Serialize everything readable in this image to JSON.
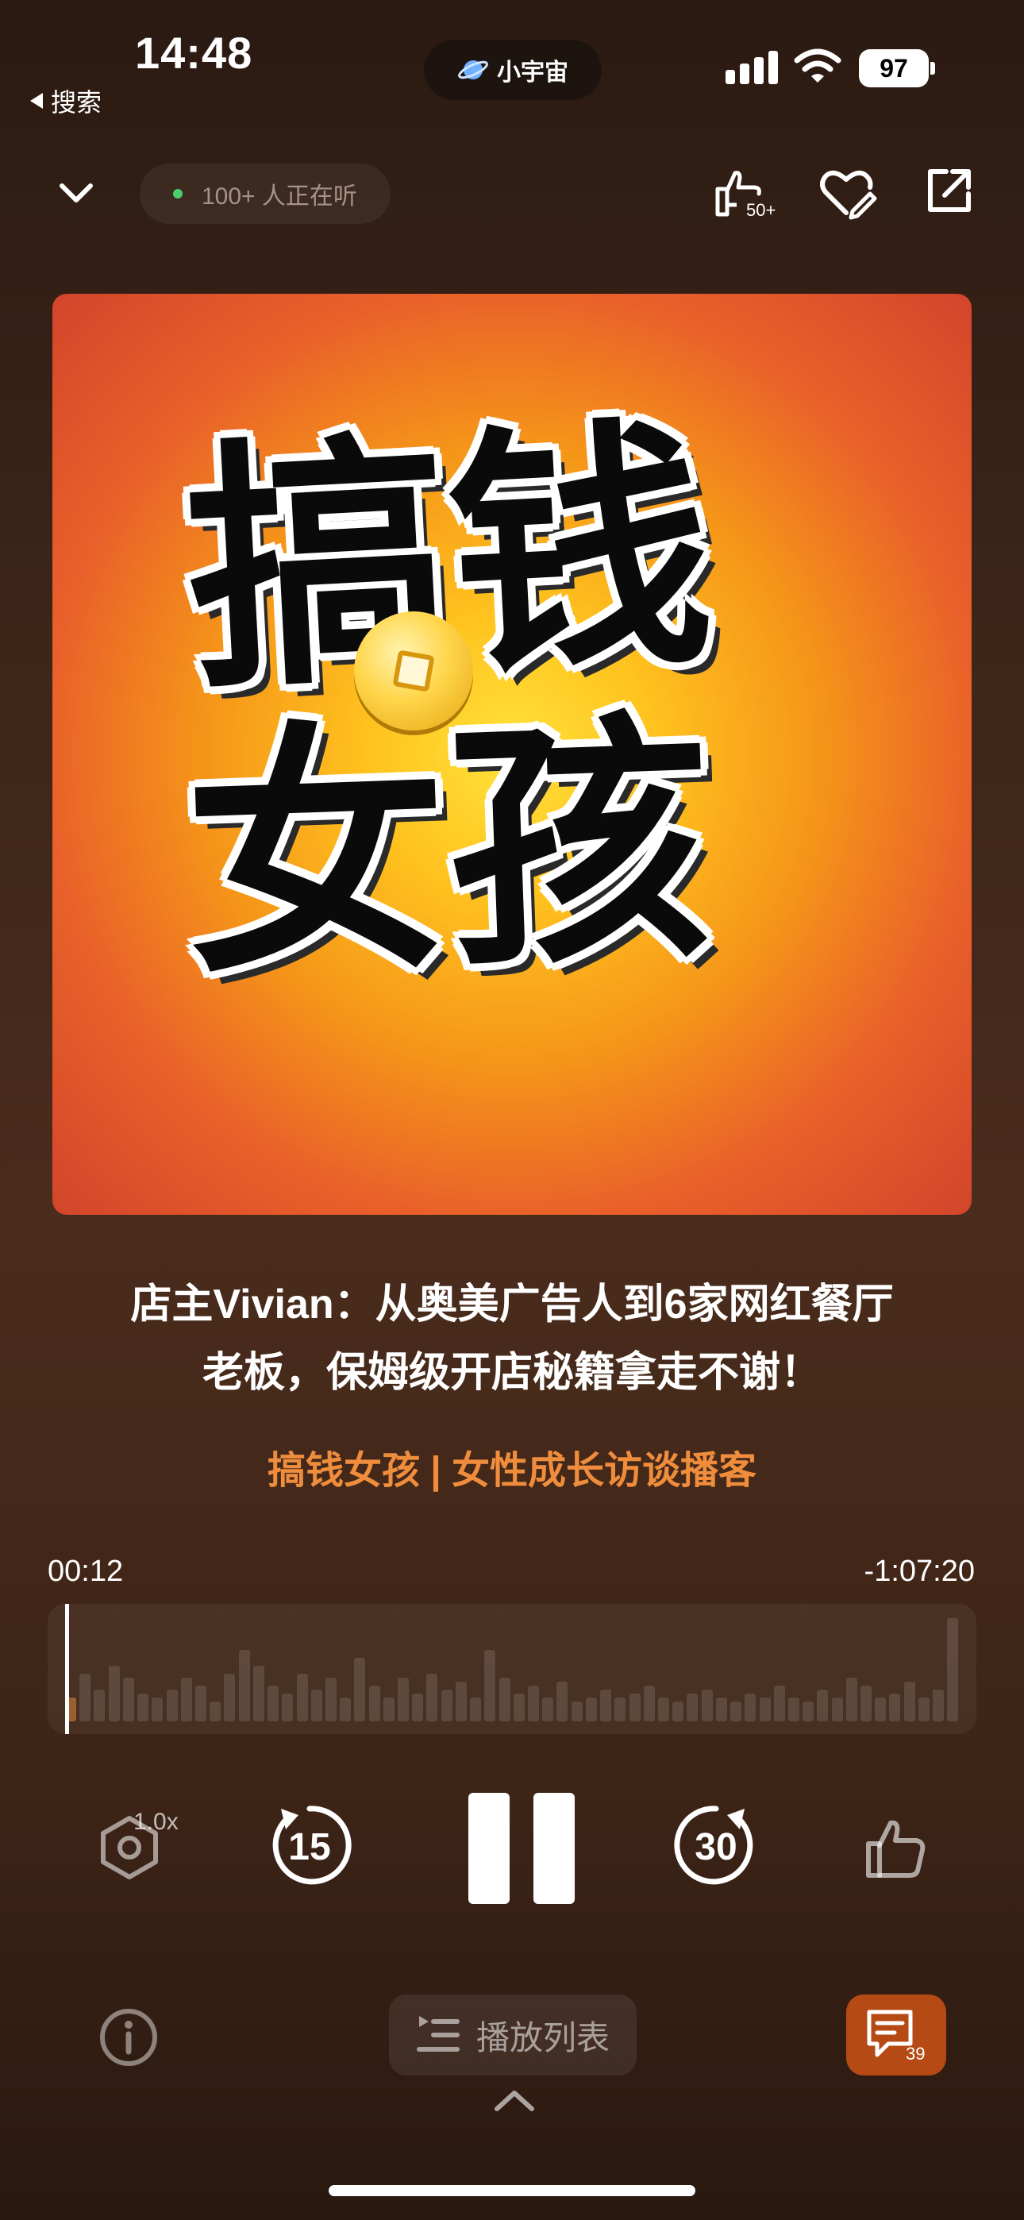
{
  "status_bar": {
    "time": "14:48",
    "back_label": "搜索",
    "app_pill": "小宇宙",
    "battery": "97"
  },
  "header": {
    "listening": "100+ 人正在听",
    "recommend_count": "50+"
  },
  "cover": {
    "line1": "搞钱",
    "line2": "女孩"
  },
  "episode": {
    "title_line1": "店主Vivian：从奥美广告人到6家网红餐厅",
    "title_line2": "老板，保姆级开店秘籍拿走不谢！",
    "podcast": "搞钱女孩 | 女性成长访谈播客"
  },
  "progress": {
    "elapsed": "00:12",
    "remaining": "-1:07:20"
  },
  "controls": {
    "speed": "1.0x",
    "rewind": "15",
    "forward": "30"
  },
  "bottom": {
    "playlist": "播放列表",
    "comment_count": "39"
  },
  "colors": {
    "accent": "#ef8d3c",
    "comment_button": "#b54a14"
  }
}
